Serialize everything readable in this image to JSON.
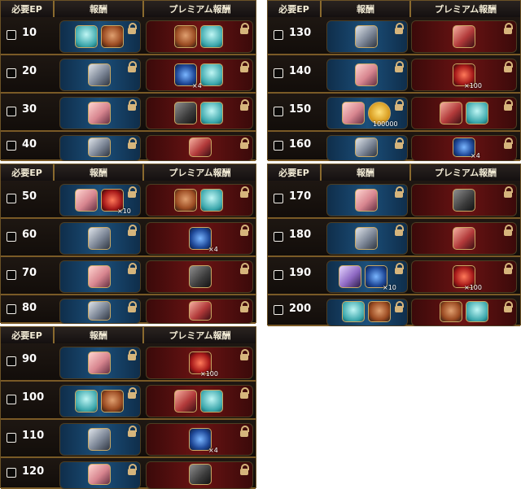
{
  "header": {
    "ep_label": "必要EP",
    "reward_label": "報酬",
    "premium_label": "プレミアム報酬"
  },
  "panels": [
    {
      "rows": [
        {
          "level": "10",
          "reward": [
            "egg",
            "bag"
          ],
          "premium": [
            "bag",
            "egg"
          ]
        },
        {
          "level": "20",
          "reward": [
            "silver"
          ],
          "premium": [
            "gem-blue",
            "egg"
          ],
          "premium_qty": "×4"
        },
        {
          "level": "30",
          "reward": [
            "pink"
          ],
          "premium": [
            "dark",
            "egg"
          ]
        },
        {
          "level": "40",
          "reward": [
            "silver"
          ],
          "premium": [
            "redhair"
          ]
        }
      ]
    },
    {
      "rows": [
        {
          "level": "130",
          "reward": [
            "silver"
          ],
          "premium": [
            "redhair"
          ]
        },
        {
          "level": "140",
          "reward": [
            "pink"
          ],
          "premium": [
            "gem-red"
          ],
          "premium_qty": "×100"
        },
        {
          "level": "150",
          "reward": [
            "pink",
            "gold"
          ],
          "premium": [
            "redhair",
            "egg"
          ],
          "reward_qty": "100000"
        },
        {
          "level": "160",
          "reward": [
            "silver"
          ],
          "premium": [
            "gem-blue"
          ],
          "premium_qty": "×4"
        }
      ]
    },
    {
      "rows": [
        {
          "level": "50",
          "reward": [
            "pink",
            "gem-red"
          ],
          "premium": [
            "bag",
            "egg"
          ],
          "reward_qty": "×10"
        },
        {
          "level": "60",
          "reward": [
            "silver"
          ],
          "premium": [
            "gem-blue"
          ],
          "premium_qty": "×4"
        },
        {
          "level": "70",
          "reward": [
            "pink"
          ],
          "premium": [
            "dark"
          ]
        },
        {
          "level": "80",
          "reward": [
            "silver"
          ],
          "premium": [
            "redhair"
          ]
        }
      ]
    },
    {
      "rows": [
        {
          "level": "170",
          "reward": [
            "pink"
          ],
          "premium": [
            "dark"
          ]
        },
        {
          "level": "180",
          "reward": [
            "silver"
          ],
          "premium": [
            "redhair"
          ]
        },
        {
          "level": "190",
          "reward": [
            "purple",
            "gem-blue"
          ],
          "premium": [
            "gem-red"
          ],
          "reward_qty": "×10",
          "premium_qty": "×100"
        },
        {
          "level": "200",
          "reward": [
            "egg",
            "bag"
          ],
          "premium": [
            "bag",
            "egg"
          ]
        }
      ]
    },
    {
      "rows": [
        {
          "level": "90",
          "reward": [
            "pink"
          ],
          "premium": [
            "gem-red"
          ],
          "premium_qty": "×100"
        },
        {
          "level": "100",
          "reward": [
            "egg",
            "bag"
          ],
          "premium": [
            "redhair",
            "egg"
          ]
        },
        {
          "level": "110",
          "reward": [
            "silver"
          ],
          "premium": [
            "gem-blue"
          ],
          "premium_qty": "×4"
        },
        {
          "level": "120",
          "reward": [
            "pink"
          ],
          "premium": [
            "dark"
          ]
        }
      ]
    }
  ]
}
